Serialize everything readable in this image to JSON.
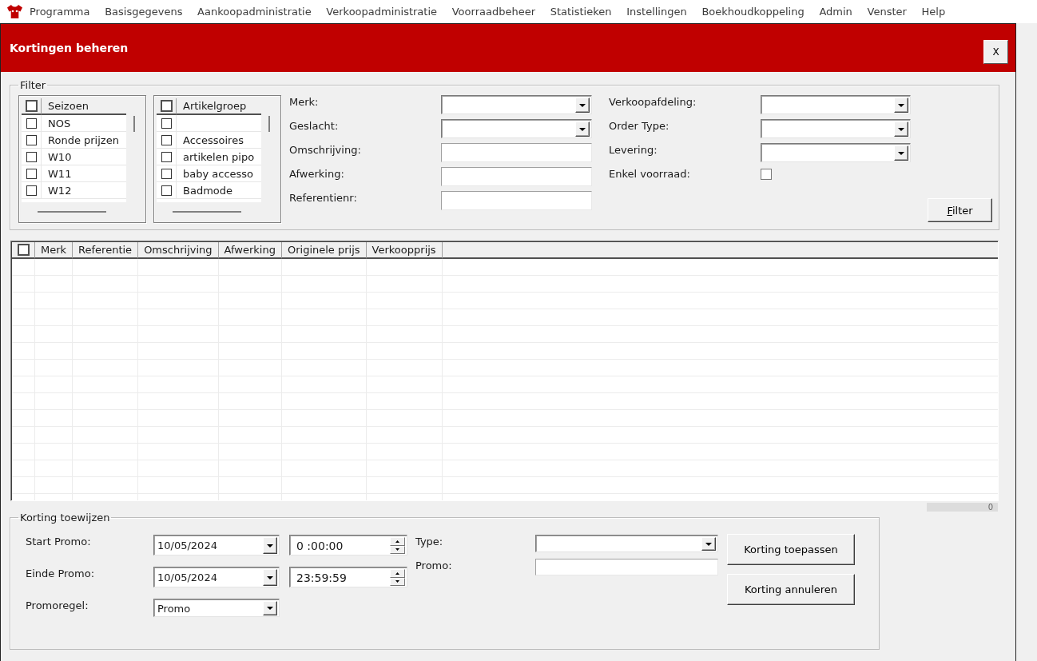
{
  "menu_bar": [
    "Programma",
    "Basisgegevens",
    "Aankoopadministratie",
    "Verkoopadministratie",
    "Voorraadbeheer",
    "Statistieken",
    "Instellingen",
    "Boekhoudkoppeling",
    "Admin",
    "Venster",
    "Help"
  ],
  "window": {
    "title": "Kortingen beheren",
    "close_label": "X"
  },
  "filter": {
    "title": "Filter",
    "lists": [
      {
        "header": "Seizoen",
        "header_checked": false,
        "items": [
          {
            "label": "NOS",
            "checked": false
          },
          {
            "label": "Ronde prijzen",
            "checked": false
          },
          {
            "label": "W10",
            "checked": false
          },
          {
            "label": "W11",
            "checked": false
          },
          {
            "label": "W12",
            "checked": false
          }
        ]
      },
      {
        "header": "Artikelgroep",
        "header_checked": false,
        "items": [
          {
            "checked": false
          },
          {
            "label": "Accessoires",
            "checked": false
          },
          {
            "label": "artikelen pipo",
            "checked": false
          },
          {
            "label": "baby accesso",
            "checked": false
          },
          {
            "label": "Badmode",
            "checked": false
          }
        ]
      }
    ],
    "fields": [
      {
        "label": "Merk:",
        "kind": "dropdown"
      },
      {
        "label": "Geslacht:",
        "kind": "dropdown"
      },
      {
        "label": "Omschrijving:",
        "kind": "text"
      },
      {
        "label": "Afwerking:",
        "kind": "text"
      },
      {
        "label": "Referentienr:",
        "kind": "text"
      }
    ],
    "fields_right": [
      {
        "label": "Verkoopafdeling:",
        "kind": "dropdown"
      },
      {
        "label": "Order Type:",
        "kind": "dropdown"
      },
      {
        "label": "Levering:",
        "kind": "dropdown"
      },
      {
        "label": "Enkel voorraad:",
        "kind": "checkbox",
        "checked": false
      }
    ],
    "button": {
      "label": "Filter",
      "mnemonic": true
    }
  },
  "table": {
    "select_all_checked": false,
    "columns": [
      "Merk",
      "Referentie",
      "Omschrijving",
      "Afwerking",
      "Originele prijs",
      "Verkoopprijs"
    ]
  },
  "record_count": "0",
  "discount": {
    "title": "Korting toewijzen",
    "fields": [
      {
        "label": "Start Promo:",
        "kind": "datetime",
        "date": "10/05/2024",
        "time": "0 :00:00"
      },
      {
        "label": "Einde Promo:",
        "kind": "datetime",
        "date": "10/05/2024",
        "time": "23:59:59"
      },
      {
        "label": "Promoregel:",
        "kind": "dropdown",
        "value": "Promo"
      }
    ],
    "fields_right": [
      {
        "label": "Type:",
        "kind": "dropdown"
      },
      {
        "label": "Promo:",
        "kind": "text"
      }
    ],
    "buttons": [
      "Korting toepassen",
      "Korting annuleren"
    ]
  }
}
